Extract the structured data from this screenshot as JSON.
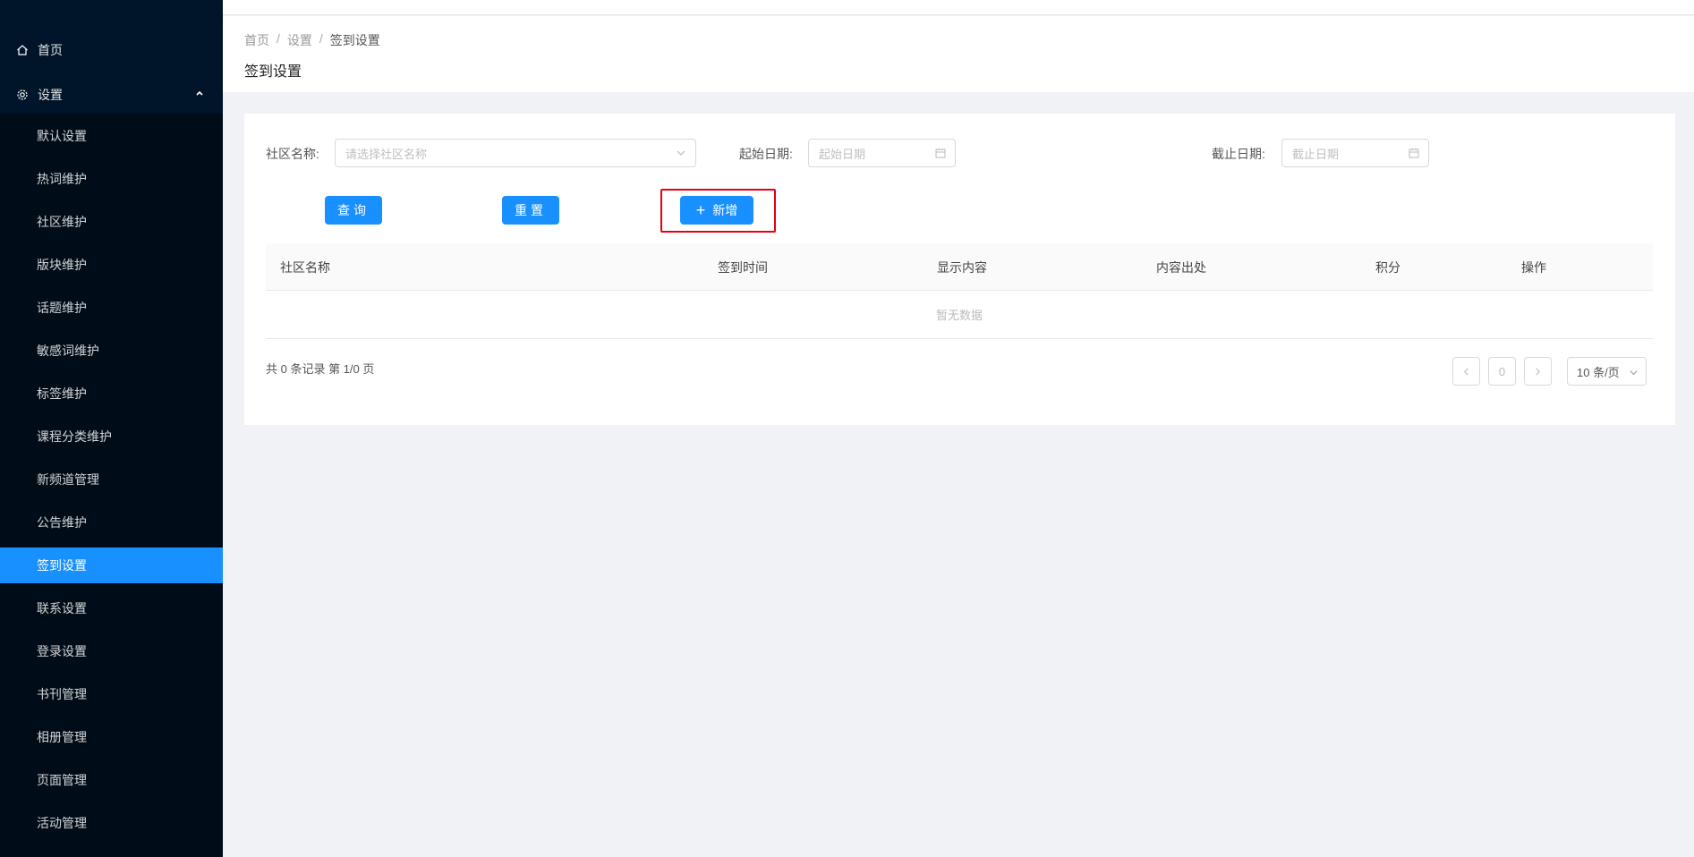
{
  "sidebar": {
    "home": "首页",
    "settings": "设置",
    "items": [
      {
        "label": "默认设置"
      },
      {
        "label": "热词维护"
      },
      {
        "label": "社区维护"
      },
      {
        "label": "版块维护"
      },
      {
        "label": "话题维护"
      },
      {
        "label": "敏感词维护"
      },
      {
        "label": "标签维护"
      },
      {
        "label": "课程分类维护"
      },
      {
        "label": "新频道管理"
      },
      {
        "label": "公告维护"
      },
      {
        "label": "签到设置",
        "active": true
      },
      {
        "label": "联系设置"
      },
      {
        "label": "登录设置"
      },
      {
        "label": "书刊管理"
      },
      {
        "label": "相册管理"
      },
      {
        "label": "页面管理"
      },
      {
        "label": "活动管理"
      }
    ]
  },
  "breadcrumb": {
    "home": "首页",
    "settings": "设置",
    "current": "签到设置",
    "separator": "/"
  },
  "page_title": "签到设置",
  "filters": {
    "community_label": "社区名称:",
    "community_placeholder": "请选择社区名称",
    "start_label": "起始日期:",
    "start_placeholder": "起始日期",
    "end_label": "截止日期:",
    "end_placeholder": "截止日期"
  },
  "buttons": {
    "query": "查询",
    "reset": "重置",
    "add": "新增"
  },
  "table": {
    "columns": [
      "社区名称",
      "签到时间",
      "显示内容",
      "内容出处",
      "积分",
      "操作"
    ],
    "empty_text": "暂无数据"
  },
  "pagination": {
    "summary": "共 0 条记录 第 1/0 页",
    "current_page": "0",
    "page_size": "10 条/页"
  },
  "colors": {
    "sidebar_bg": "#001529",
    "primary": "#1890ff",
    "highlight_border": "#e60012"
  }
}
